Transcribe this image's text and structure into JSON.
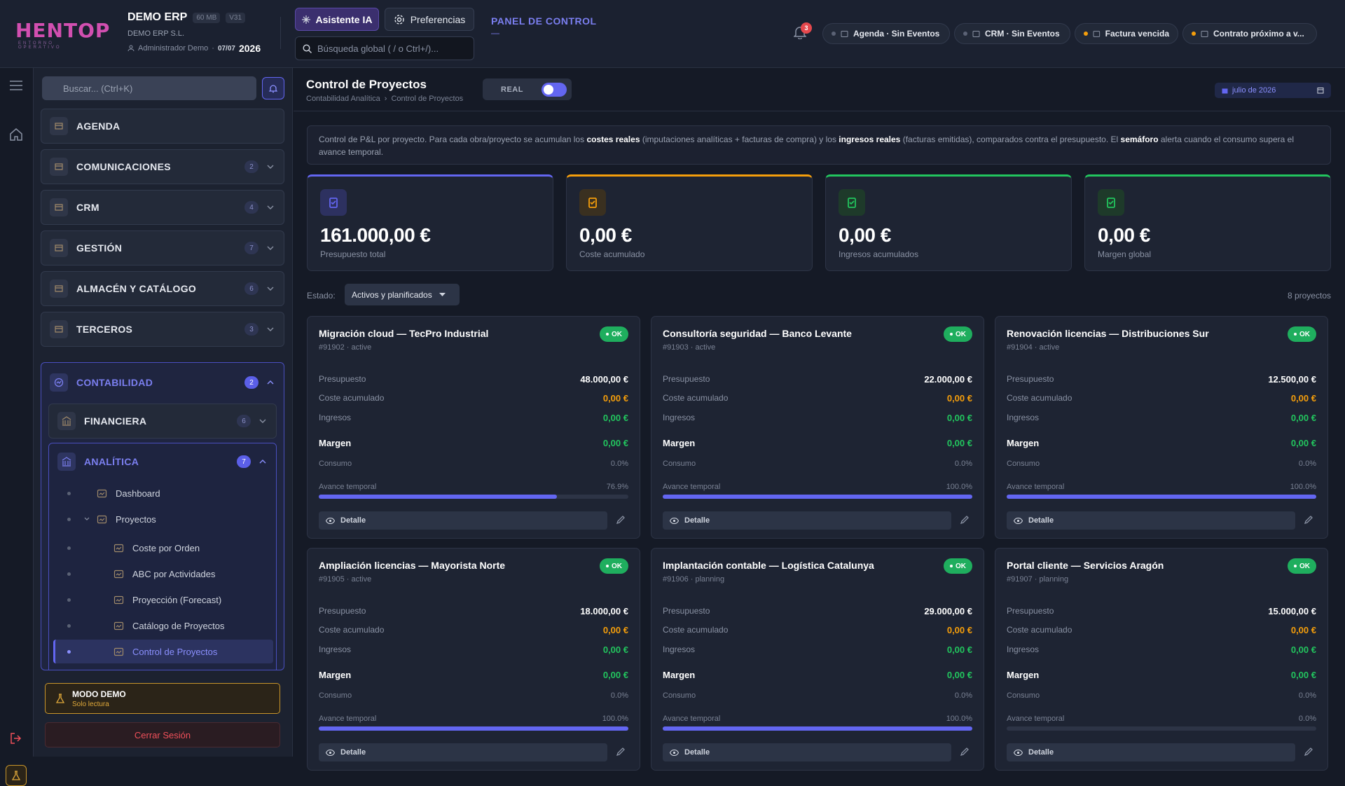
{
  "header": {
    "logo_text": "HENTOP",
    "logo_sub": "ENTORNO OPERATIVO",
    "company": "DEMO ERP",
    "tag_size": "60 MB",
    "tag_version": "V31",
    "company_sub": "DEMO ERP S.L.",
    "user": "Administrador Demo",
    "date_day": "07/07",
    "date_year": "2026",
    "ai_button": "Asistente IA",
    "pref_button": "Preferencias",
    "search_placeholder": "Búsqueda global ( / o Ctrl+/)...",
    "panel_title": "PANEL DE CONTROL",
    "panel_sub": "—",
    "bell_count": "3",
    "chips": [
      {
        "label": "Agenda · Sin Eventos",
        "dot": "#5b6275"
      },
      {
        "label": "CRM · Sin Eventos",
        "dot": "#5b6275"
      },
      {
        "label": "Factura vencida",
        "dot": "#f59e0b"
      },
      {
        "label": "Contrato próximo a v...",
        "dot": "#f59e0b"
      }
    ]
  },
  "sidebar": {
    "search_placeholder": "Buscar... (Ctrl+K)",
    "modules": [
      {
        "label": "AGENDA",
        "count": ""
      },
      {
        "label": "COMUNICACIONES",
        "count": "2"
      },
      {
        "label": "CRM",
        "count": "4"
      },
      {
        "label": "GESTIÓN",
        "count": "7"
      },
      {
        "label": "ALMACÉN Y CATÁLOGO",
        "count": "6"
      },
      {
        "label": "TERCEROS",
        "count": "3"
      }
    ],
    "accounting": {
      "label": "CONTABILIDAD",
      "count": "2"
    },
    "financial": {
      "label": "FINANCIERA",
      "count": "6"
    },
    "analytics": {
      "label": "ANALÍTICA",
      "count": "7"
    },
    "sub_items": [
      "Dashboard",
      "Proyectos",
      "Coste por Orden",
      "ABC por Actividades",
      "Proyección (Forecast)",
      "Catálogo de Proyectos",
      "Control de Proyectos"
    ],
    "demo_title": "MODO DEMO",
    "demo_sub": "Solo lectura",
    "logout": "Cerrar Sesión"
  },
  "main": {
    "title": "Control de Proyectos",
    "breadcrumb": [
      "Contabilidad Analítica",
      "Control de Proyectos"
    ],
    "breadcrumb_sep": "›",
    "real_label": "REAL",
    "date": "julio de 2026",
    "info": {
      "t1": "Control de P&L por proyecto. Para cada obra/proyecto se acumulan los ",
      "b1": "costes reales",
      "t2": " (imputaciones analíticas + facturas de compra) y los ",
      "b2": "ingresos reales",
      "t3": " (facturas emitidas), comparados contra el presupuesto. El ",
      "b3": "semáforo",
      "t4": " alerta cuando el consumo supera el avance temporal."
    },
    "kpis": [
      {
        "value": "161.000,00 €",
        "label": "Presupuesto total",
        "color": "#6366f1",
        "icon": "clipboard-icon"
      },
      {
        "value": "0,00 €",
        "label": "Coste acumulado",
        "color": "#f59e0b",
        "icon": "coins-icon"
      },
      {
        "value": "0,00 €",
        "label": "Ingresos acumulados",
        "color": "#22c55e",
        "icon": "hand-coin-icon"
      },
      {
        "value": "0,00 €",
        "label": "Margen global",
        "color": "#22c55e",
        "icon": "scale-icon"
      }
    ],
    "filter_label": "Estado:",
    "filter_value": "Activos y planificados",
    "count": "8 proyectos",
    "labels": {
      "budget": "Presupuesto",
      "cost": "Coste acumulado",
      "income": "Ingresos",
      "margin": "Margen",
      "consumption": "Consumo",
      "progress": "Avance temporal",
      "detail": "Detalle",
      "ok": "OK"
    },
    "projects": [
      {
        "title": "Migración cloud — TecPro Industrial",
        "sub": "#91902 · active",
        "budget": "48.000,00 €",
        "cost": "0,00 €",
        "income": "0,00 €",
        "margin": "0,00 €",
        "consumption": "0.0%",
        "progress_text": "76.9%",
        "progress": 0.769
      },
      {
        "title": "Consultoría seguridad — Banco Levante",
        "sub": "#91903 · active",
        "budget": "22.000,00 €",
        "cost": "0,00 €",
        "income": "0,00 €",
        "margin": "0,00 €",
        "consumption": "0.0%",
        "progress_text": "100.0%",
        "progress": 1.0
      },
      {
        "title": "Renovación licencias — Distribuciones Sur",
        "sub": "#91904 · active",
        "budget": "12.500,00 €",
        "cost": "0,00 €",
        "income": "0,00 €",
        "margin": "0,00 €",
        "consumption": "0.0%",
        "progress_text": "100.0%",
        "progress": 1.0
      },
      {
        "title": "Ampliación licencias — Mayorista Norte",
        "sub": "#91905 · active",
        "budget": "18.000,00 €",
        "cost": "0,00 €",
        "income": "0,00 €",
        "margin": "0,00 €",
        "consumption": "0.0%",
        "progress_text": "100.0%",
        "progress": 1.0
      },
      {
        "title": "Implantación contable — Logística Catalunya",
        "sub": "#91906 · planning",
        "budget": "29.000,00 €",
        "cost": "0,00 €",
        "income": "0,00 €",
        "margin": "0,00 €",
        "consumption": "0.0%",
        "progress_text": "100.0%",
        "progress": 1.0
      },
      {
        "title": "Portal cliente — Servicios Aragón",
        "sub": "#91907 · planning",
        "budget": "15.000,00 €",
        "cost": "0,00 €",
        "income": "0,00 €",
        "margin": "0,00 €",
        "consumption": "0.0%",
        "progress_text": "0.0%",
        "progress": 0.0
      }
    ]
  }
}
